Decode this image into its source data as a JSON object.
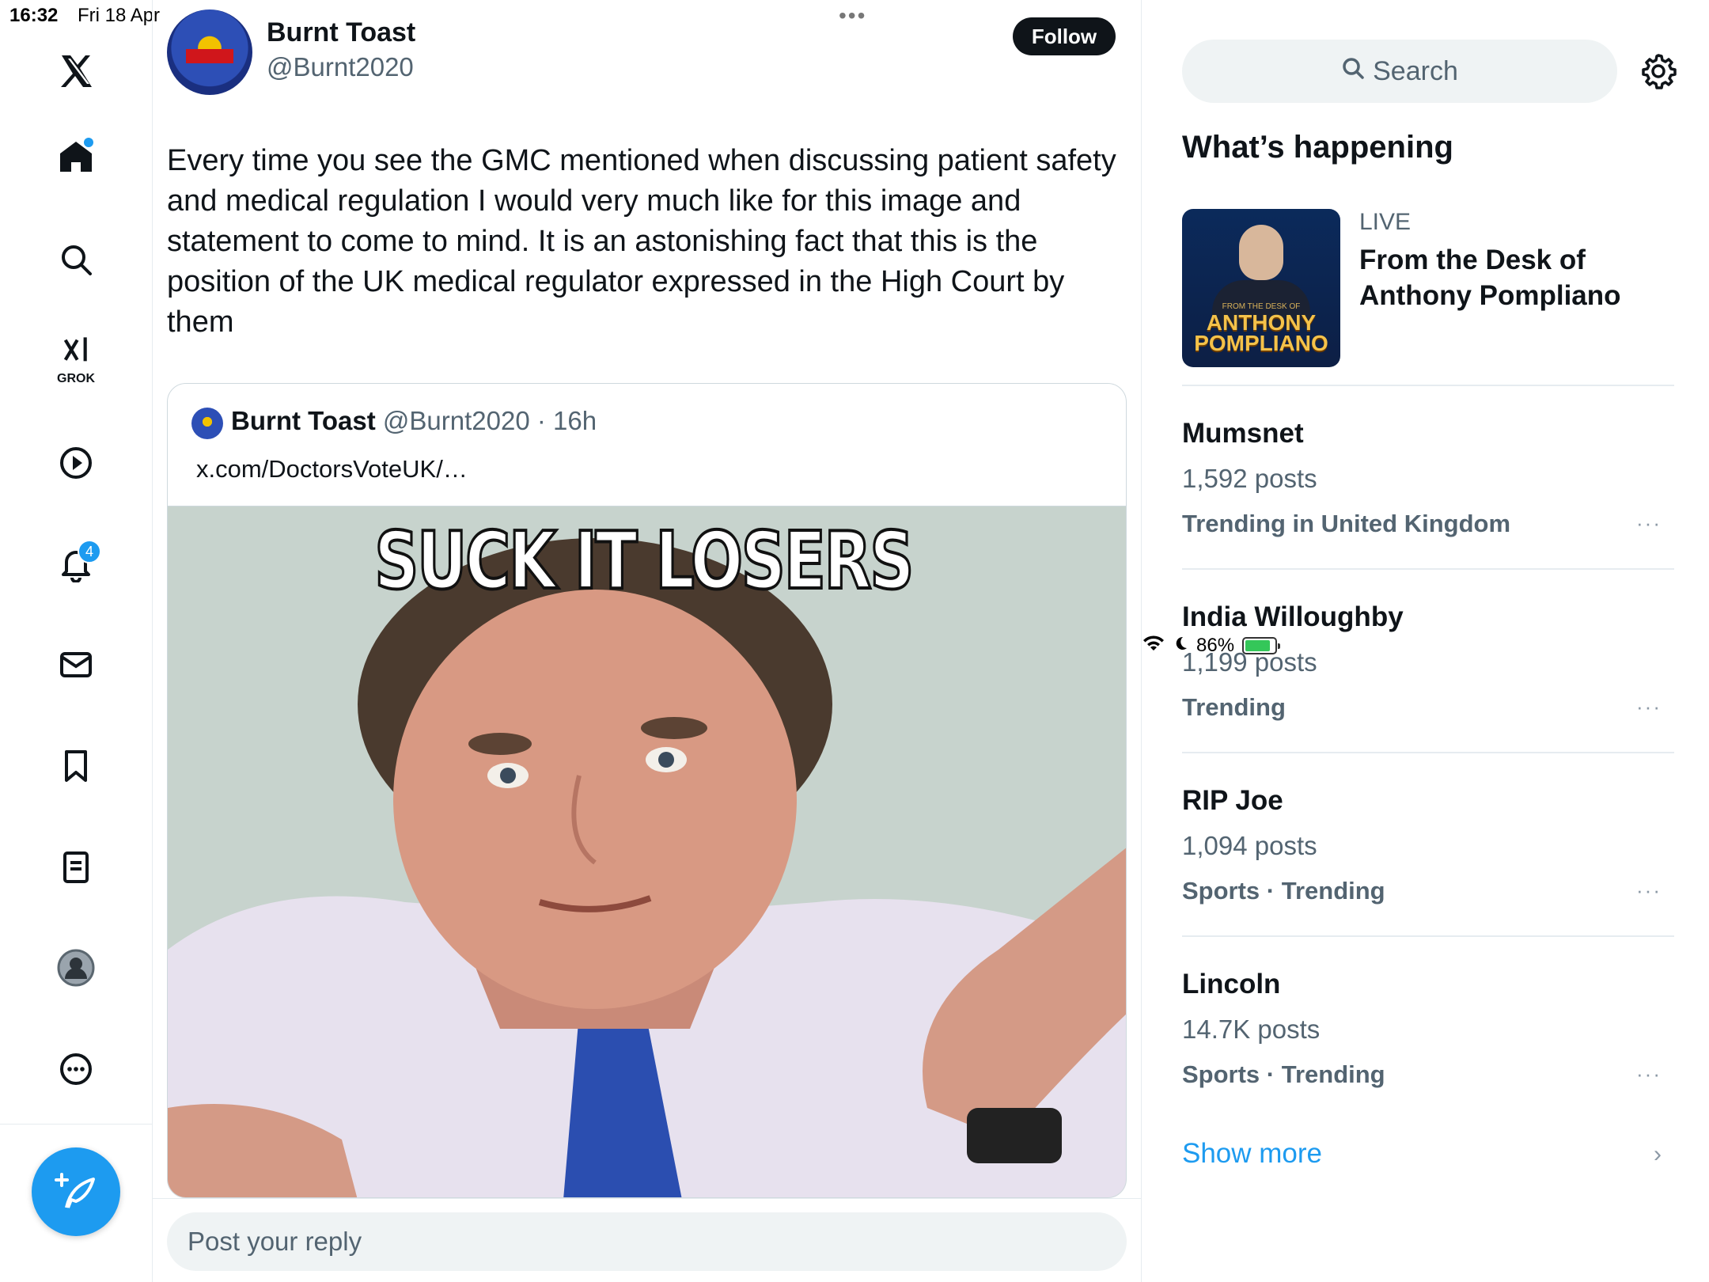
{
  "status_bar": {
    "time": "16:32",
    "date": "Fri 18 Apr",
    "battery": "86%",
    "battery_level": 0.86
  },
  "nav": {
    "grok_label": "GROK",
    "notifications_badge": "4"
  },
  "tweet": {
    "author_name": "Burnt Toast",
    "author_handle": "@Burnt2020",
    "follow_label": "Follow",
    "text": "Every time you see the GMC mentioned when discussing patient safety and medical regulation I would very much like for this image and statement to come to mind. It is an astonishing fact that this is the position of the UK medical regulator expressed in the High Court by them",
    "quote": {
      "name": "Burnt Toast",
      "handle": "@Burnt2020",
      "time": "· 16h",
      "link": "x.com/DoctorsVoteUK/…",
      "image_caption": "SUCK IT LOSERS"
    }
  },
  "reply": {
    "placeholder": "Post your reply"
  },
  "sidebar": {
    "search_placeholder": "Search",
    "section_title": "What’s happening",
    "live": {
      "label": "LIVE",
      "title": "From the Desk of Anthony Pompliano",
      "thumb_small": "FROM THE DESK OF",
      "thumb_line1": "ANTHONY",
      "thumb_line2": "POMPLIANO"
    },
    "trends": [
      {
        "name": "Mumsnet",
        "count": "1,592 posts",
        "context": "Trending in United Kingdom"
      },
      {
        "name": "India Willoughby",
        "count": "1,199 posts",
        "context": "Trending"
      },
      {
        "name": "RIP Joe",
        "count": "1,094 posts",
        "context": "Sports · Trending"
      },
      {
        "name": "Lincoln",
        "count": "14.7K posts",
        "context": "Sports · Trending"
      }
    ],
    "more_glyph": "···",
    "show_more": "Show more"
  },
  "colors": {
    "accent": "#1d9bf0",
    "text": "#0f1419",
    "secondary": "#536471",
    "border": "#e6ecf0"
  }
}
